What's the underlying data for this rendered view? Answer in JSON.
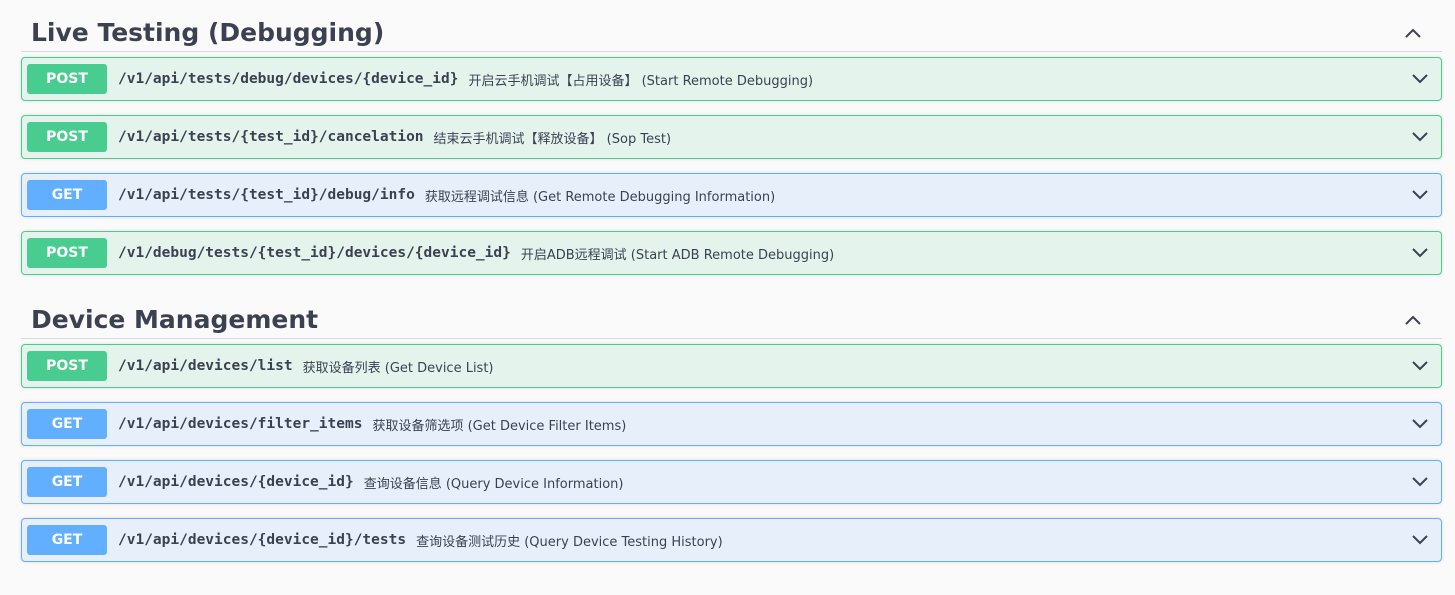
{
  "sections": [
    {
      "title": "Live Testing (Debugging)",
      "collapse_icon": "chevron-up-icon",
      "operations": [
        {
          "method": "POST",
          "path": "/v1/api/tests/debug/devices/{device_id}",
          "summary": "开启云手机调试【占用设备】 (Start Remote Debugging)"
        },
        {
          "method": "POST",
          "path": "/v1/api/tests/{test_id}/cancelation",
          "summary": "结束云手机调试【释放设备】 (Sop Test)"
        },
        {
          "method": "GET",
          "path": "/v1/api/tests/{test_id}/debug/info",
          "summary": "获取远程调试信息 (Get Remote Debugging Information)"
        },
        {
          "method": "POST",
          "path": "/v1/debug/tests/{test_id}/devices/{device_id}",
          "summary": "开启ADB远程调试 (Start ADB Remote Debugging)"
        }
      ]
    },
    {
      "title": "Device Management",
      "collapse_icon": "chevron-up-icon",
      "operations": [
        {
          "method": "POST",
          "path": "/v1/api/devices/list",
          "summary": "获取设备列表 (Get Device List)"
        },
        {
          "method": "GET",
          "path": "/v1/api/devices/filter_items",
          "summary": "获取设备筛选项 (Get Device Filter Items)"
        },
        {
          "method": "GET",
          "path": "/v1/api/devices/{device_id}",
          "summary": "查询设备信息 (Query Device Information)"
        },
        {
          "method": "GET",
          "path": "/v1/api/devices/{device_id}/tests",
          "summary": "查询设备测试历史 (Query Device Testing History)"
        }
      ]
    }
  ],
  "colors": {
    "post": "#49cc90",
    "get": "#61affe",
    "text": "#3b4151"
  },
  "expand_icon": "chevron-down-icon"
}
